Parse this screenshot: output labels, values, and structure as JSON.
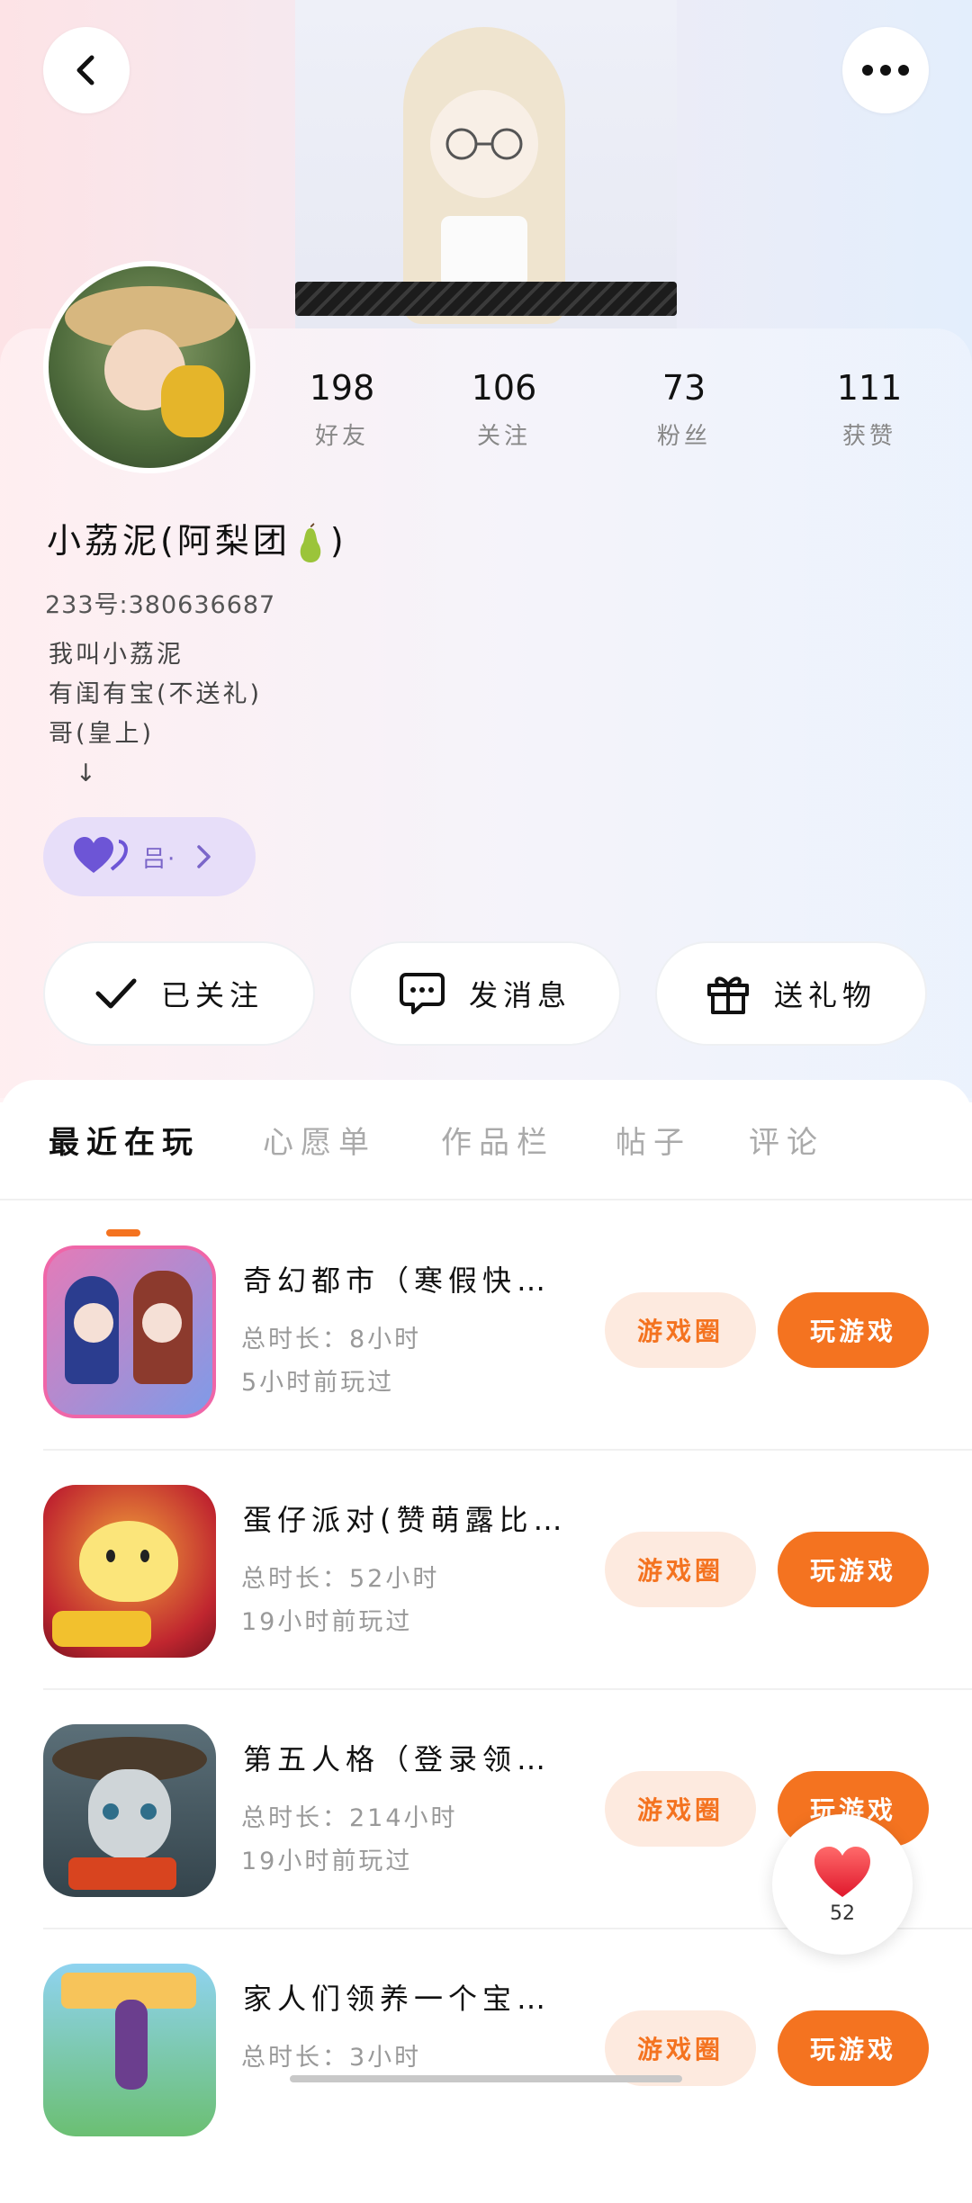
{
  "stats": [
    {
      "value": "198",
      "label": "好友"
    },
    {
      "value": "106",
      "label": "关注"
    },
    {
      "value": "73",
      "label": "粉丝"
    },
    {
      "value": "111",
      "label": "获赞"
    }
  ],
  "profile": {
    "name_prefix": "小荔泥(阿梨团",
    "name_suffix": ")",
    "uid": "233号:380636687",
    "bio": [
      "我叫小荔泥",
      "有闺有宝(不送礼)",
      "哥(皇上)",
      "↓"
    ],
    "badge_text": "吕·"
  },
  "actions": {
    "follow": "已关注",
    "message": "发消息",
    "gift": "送礼物"
  },
  "tabs": [
    "最近在玩",
    "心愿单",
    "作品栏",
    "帖子",
    "评论"
  ],
  "games": [
    {
      "title": "奇幻都市（寒假快…",
      "duration": "总时长：8小时",
      "last_played": "5小时前玩过"
    },
    {
      "title": "蛋仔派对(赞萌露比…",
      "duration": "总时长：52小时",
      "last_played": "19小时前玩过"
    },
    {
      "title": "第五人格（登录领…",
      "duration": "总时长：214小时",
      "last_played": "19小时前玩过"
    },
    {
      "title": "家人们领养一个宝…",
      "duration": "总时长：3小时",
      "last_played": ""
    }
  ],
  "game_buttons": {
    "circle": "游戏圈",
    "play": "玩游戏"
  },
  "like_count": "52",
  "colors": {
    "accent": "#f47320",
    "accent_light": "#fdeadf",
    "badge_bg": "#e7def9",
    "badge_fg": "#7b66c9"
  }
}
